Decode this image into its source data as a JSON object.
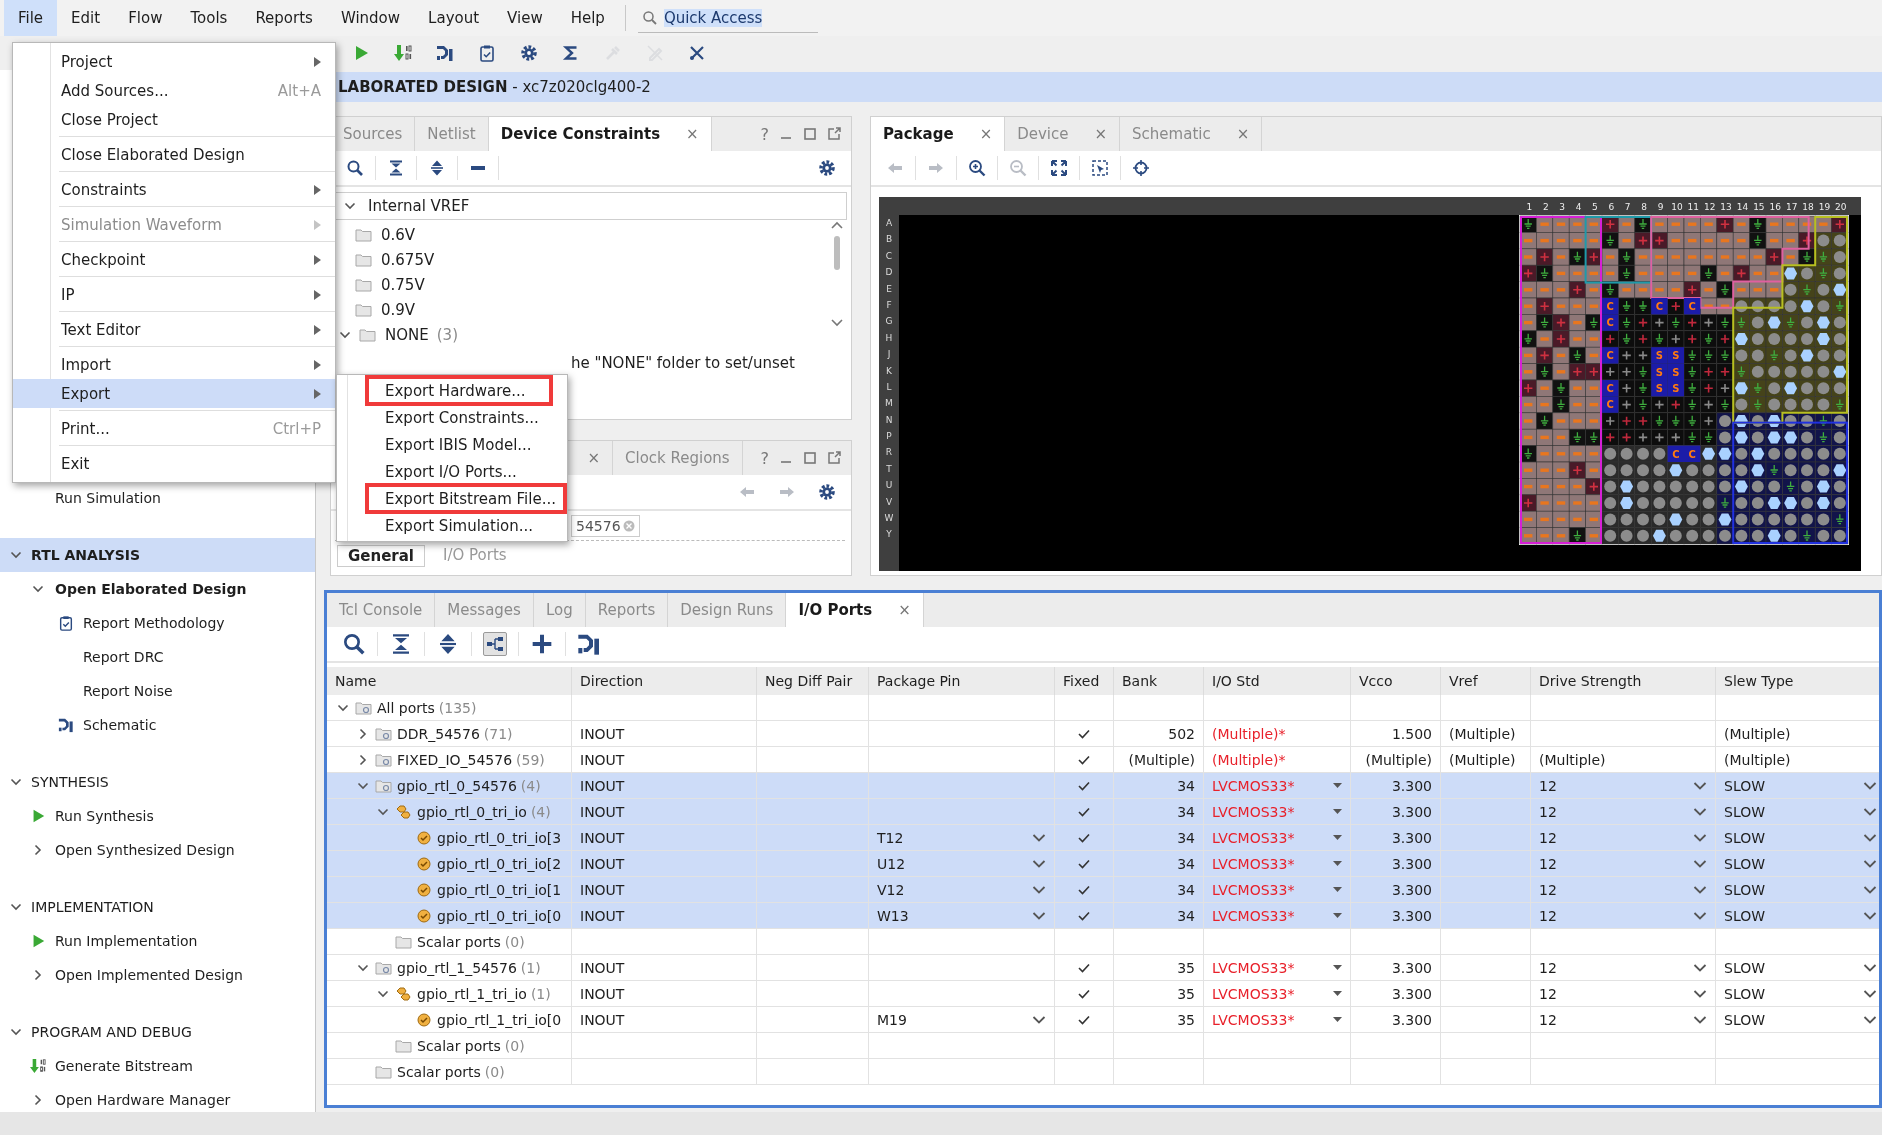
{
  "menu_bar": {
    "items": [
      {
        "label": "File",
        "selected": true
      },
      {
        "label": "Edit",
        "selected": false
      },
      {
        "label": "Flow",
        "selected": false
      },
      {
        "label": "Tools",
        "selected": false
      },
      {
        "label": "Reports",
        "selected": false
      },
      {
        "label": "Window",
        "selected": false
      },
      {
        "label": "Layout",
        "selected": false
      },
      {
        "label": "View",
        "selected": false
      },
      {
        "label": "Help",
        "selected": false
      }
    ]
  },
  "quick_access": {
    "value": "Quick Access"
  },
  "toolbar": [
    {
      "kind": "run",
      "disabled": false
    },
    {
      "kind": "bitstream",
      "disabled": false
    },
    {
      "kind": "schematic",
      "disabled": false
    },
    {
      "kind": "report",
      "disabled": false
    },
    {
      "kind": "settings",
      "disabled": false
    },
    {
      "kind": "sum",
      "disabled": false
    },
    {
      "kind": "probe",
      "disabled": true
    },
    {
      "kind": "pen",
      "disabled": true
    },
    {
      "kind": "tools",
      "disabled": false
    }
  ],
  "design_header": "**LABORATED DESIGN** - xc7z020clg400-2",
  "flow_navigator": {
    "sections": [
      {
        "items": [
          {
            "label": "Run Simulation"
          }
        ]
      },
      {
        "title": "RTL ANALYSIS",
        "expanded": true,
        "selected": true,
        "items": [
          {
            "label": "Open Elaborated Design",
            "expanded": true,
            "active": true,
            "children": [
              {
                "label": "Report Methodology",
                "kind": "report"
              },
              {
                "label": "Report DRC"
              },
              {
                "label": "Report Noise"
              },
              {
                "label": "Schematic",
                "kind": "schematic"
              }
            ]
          }
        ]
      },
      {
        "title": "SYNTHESIS",
        "expanded": true,
        "selected": false,
        "items": [
          {
            "label": "Run Synthesis",
            "kind": "run"
          },
          {
            "label": "Open Synthesized Design",
            "expanded": false,
            "active": false
          }
        ]
      },
      {
        "title": "IMPLEMENTATION",
        "expanded": true,
        "selected": false,
        "items": [
          {
            "label": "Run Implementation",
            "kind": "run"
          },
          {
            "label": "Open Implemented Design",
            "expanded": false,
            "active": false
          }
        ]
      },
      {
        "title": "PROGRAM AND DEBUG",
        "expanded": true,
        "selected": false,
        "items": [
          {
            "label": "Generate Bitstream",
            "kind": "bitstream"
          },
          {
            "label": "Open Hardware Manager",
            "expanded": false,
            "active": false
          }
        ]
      }
    ]
  },
  "device_constraints_panel": {
    "tabs": [
      {
        "label": "Sources",
        "selected": false
      },
      {
        "label": "Netlist",
        "selected": false
      },
      {
        "label": "Device Constraints",
        "selected": true,
        "close": "×"
      }
    ],
    "help": "?",
    "toolbar": [
      {
        "kind": "search",
        "disabled": false
      },
      {
        "kind": "collapse",
        "disabled": false
      },
      {
        "kind": "expand",
        "disabled": false
      },
      {
        "kind": "minus",
        "disabled": false
      },
      {
        "kind": "settings",
        "disabled": false
      }
    ],
    "tree_header": {
      "label": "Internal VREF",
      "expanded": true
    },
    "tree": [
      {
        "label": "0.6V"
      },
      {
        "label": "0.675V"
      },
      {
        "label": "0.75V"
      },
      {
        "label": "0.9V"
      },
      {
        "label": "NONE",
        "count": "(3)",
        "expanded": true
      }
    ],
    "hint": "he \"NONE\" folder to set/unset"
  },
  "properties_panel": {
    "tabs": [
      {
        "close": "×",
        "selected": false
      },
      {
        "label": "Clock Regions",
        "selected": false
      }
    ],
    "help": "?",
    "toolbar": [
      {
        "kind": "back",
        "disabled": true
      },
      {
        "kind": "forward",
        "disabled": true
      },
      {
        "kind": "settings",
        "disabled": false
      }
    ],
    "filter_value": "54576",
    "bottom_tabs": [
      {
        "label": "General",
        "selected": true
      },
      {
        "label": "I/O Ports",
        "selected": false
      }
    ]
  },
  "package_panel": {
    "tabs": [
      {
        "label": "Package",
        "selected": true,
        "close": "×"
      },
      {
        "label": "Device",
        "selected": false,
        "close": "×"
      },
      {
        "label": "Schematic",
        "selected": false,
        "close": "×"
      }
    ],
    "toolbar": [
      {
        "kind": "back",
        "disabled": true
      },
      {
        "kind": "forward",
        "disabled": true
      },
      {
        "kind": "zoom_in",
        "disabled": false
      },
      {
        "kind": "zoom_out",
        "disabled": true
      },
      {
        "kind": "fit",
        "disabled": false
      },
      {
        "kind": "zoom_area",
        "disabled": false
      },
      {
        "kind": "locate",
        "disabled": false
      }
    ],
    "column_labels": [
      "1",
      "2",
      "3",
      "4",
      "5",
      "6",
      "7",
      "8",
      "9",
      "10",
      "11",
      "12",
      "13",
      "14",
      "15",
      "16",
      "17",
      "18",
      "19",
      "20"
    ],
    "row_labels": [
      "A",
      "B",
      "C",
      "D",
      "E",
      "F",
      "G",
      "H",
      "J",
      "K",
      "L",
      "M",
      "N",
      "P",
      "R",
      "T",
      "U",
      "V",
      "W",
      "Y"
    ],
    "pin_labels": [
      {
        "text": "C"
      },
      {
        "text": "C"
      },
      {
        "text": "C"
      },
      {
        "text": "C"
      },
      {
        "text": "C"
      },
      {
        "text": "C"
      },
      {
        "text": "C"
      },
      {
        "text": "S"
      },
      {
        "text": "S"
      },
      {
        "text": "S"
      },
      {
        "text": "S"
      },
      {
        "text": "S"
      },
      {
        "text": "S"
      },
      {
        "text": "C"
      },
      {
        "text": "C"
      }
    ]
  },
  "bottom_panel": {
    "tabs": [
      {
        "label": "Tcl Console",
        "selected": false
      },
      {
        "label": "Messages",
        "selected": false
      },
      {
        "label": "Log",
        "selected": false
      },
      {
        "label": "Reports",
        "selected": false
      },
      {
        "label": "Design Runs",
        "selected": false
      },
      {
        "label": "I/O Ports",
        "selected": true,
        "close": "×"
      }
    ],
    "toolbar": [
      {
        "kind": "search",
        "pressed": false
      },
      {
        "kind": "collapse",
        "pressed": false
      },
      {
        "kind": "expand",
        "pressed": false
      },
      {
        "kind": "group",
        "pressed": true
      },
      {
        "kind": "plus",
        "pressed": false
      },
      {
        "kind": "schematic",
        "pressed": false
      }
    ],
    "columns": [
      "Name",
      "Direction",
      "Neg Diff Pair",
      "Package Pin",
      "Fixed",
      "Bank",
      "I/O Std",
      "Vcco",
      "Vref",
      "Drive Strength",
      "Slew Type"
    ],
    "rows": [
      {
        "name": "All ports",
        "count": "(135)",
        "kind": "group",
        "expanded": true,
        "selected": false,
        "children": [
          {
            "name": "DDR_54576",
            "count": "(71)",
            "kind": "group",
            "expanded": false,
            "selected": false,
            "direction": "INOUT",
            "fixed": true,
            "bank": "502",
            "io_std": "(Multiple)*",
            "vcco": "1.500",
            "vref": "(Multiple)",
            "slew_type": "(Multiple)",
            "editable": false
          },
          {
            "name": "FIXED_IO_54576",
            "count": "(59)",
            "kind": "group",
            "expanded": false,
            "selected": false,
            "direction": "INOUT",
            "fixed": true,
            "bank": "(Multiple)",
            "io_std": "(Multiple)*",
            "vcco": "(Multiple)",
            "vref": "(Multiple)",
            "drive_strength": "(Multiple)",
            "slew_type": "(Multiple)",
            "editable": false
          },
          {
            "name": "gpio_rtl_0_54576",
            "count": "(4)",
            "kind": "group",
            "expanded": true,
            "selected": true,
            "direction": "INOUT",
            "fixed": true,
            "bank": "34",
            "io_std": "LVCMOS33*",
            "vcco": "3.300",
            "drive_strength": "12",
            "slew_type": "SLOW",
            "editable": true,
            "children": [
              {
                "name": "gpio_rtl_0_tri_io",
                "count": "(4)",
                "kind": "bus",
                "expanded": true,
                "selected": true,
                "direction": "INOUT",
                "fixed": true,
                "bank": "34",
                "io_std": "LVCMOS33*",
                "vcco": "3.300",
                "drive_strength": "12",
                "slew_type": "SLOW",
                "editable": true,
                "children": [
                  {
                    "name": "gpio_rtl_0_tri_io[3",
                    "kind": "port",
                    "selected": true,
                    "direction": "INOUT",
                    "package_pin": "T12",
                    "fixed": true,
                    "bank": "34",
                    "io_std": "LVCMOS33*",
                    "vcco": "3.300",
                    "drive_strength": "12",
                    "slew_type": "SLOW",
                    "editable": true
                  },
                  {
                    "name": "gpio_rtl_0_tri_io[2",
                    "kind": "port",
                    "selected": true,
                    "direction": "INOUT",
                    "package_pin": "U12",
                    "fixed": true,
                    "bank": "34",
                    "io_std": "LVCMOS33*",
                    "vcco": "3.300",
                    "drive_strength": "12",
                    "slew_type": "SLOW",
                    "editable": true
                  },
                  {
                    "name": "gpio_rtl_0_tri_io[1",
                    "kind": "port",
                    "selected": true,
                    "direction": "INOUT",
                    "package_pin": "V12",
                    "fixed": true,
                    "bank": "34",
                    "io_std": "LVCMOS33*",
                    "vcco": "3.300",
                    "drive_strength": "12",
                    "slew_type": "SLOW",
                    "editable": true
                  },
                  {
                    "name": "gpio_rtl_0_tri_io[0",
                    "kind": "port",
                    "selected": true,
                    "direction": "INOUT",
                    "package_pin": "W13",
                    "fixed": true,
                    "bank": "34",
                    "io_std": "LVCMOS33*",
                    "vcco": "3.300",
                    "drive_strength": "12",
                    "slew_type": "SLOW",
                    "editable": true
                  }
                ]
              },
              {
                "name": "Scalar ports",
                "count": "(0)",
                "kind": "folder",
                "selected": false
              }
            ]
          },
          {
            "name": "gpio_rtl_1_54576",
            "count": "(1)",
            "kind": "group",
            "expanded": true,
            "selected": false,
            "direction": "INOUT",
            "fixed": true,
            "bank": "35",
            "io_std": "LVCMOS33*",
            "vcco": "3.300",
            "drive_strength": "12",
            "slew_type": "SLOW",
            "editable": true,
            "children": [
              {
                "name": "gpio_rtl_1_tri_io",
                "count": "(1)",
                "kind": "bus",
                "expanded": true,
                "selected": false,
                "direction": "INOUT",
                "fixed": true,
                "bank": "35",
                "io_std": "LVCMOS33*",
                "vcco": "3.300",
                "drive_strength": "12",
                "slew_type": "SLOW",
                "editable": true,
                "children": [
                  {
                    "name": "gpio_rtl_1_tri_io[0",
                    "kind": "port",
                    "selected": false,
                    "direction": "INOUT",
                    "package_pin": "M19",
                    "fixed": true,
                    "bank": "35",
                    "io_std": "LVCMOS33*",
                    "vcco": "3.300",
                    "drive_strength": "12",
                    "slew_type": "SLOW",
                    "editable": true
                  }
                ]
              },
              {
                "name": "Scalar ports",
                "count": "(0)",
                "kind": "folder",
                "selected": false
              }
            ]
          },
          {
            "name": "Scalar ports",
            "count": "(0)",
            "kind": "folder",
            "selected": false
          }
        ]
      }
    ]
  },
  "file_menu": {
    "groups": [
      [
        {
          "label": "Project",
          "submenu": true,
          "disabled": false,
          "selected": false
        },
        {
          "label": "Add Sources...",
          "shortcut": "Alt+A",
          "disabled": false,
          "selected": false
        },
        {
          "label": "Close Project",
          "disabled": false,
          "selected": false
        }
      ],
      [
        {
          "label": "Close Elaborated Design",
          "disabled": false,
          "selected": false
        }
      ],
      [
        {
          "label": "Constraints",
          "submenu": true,
          "disabled": false,
          "selected": false
        }
      ],
      [
        {
          "label": "Simulation Waveform",
          "submenu": true,
          "disabled": true,
          "selected": false
        }
      ],
      [
        {
          "label": "Checkpoint",
          "submenu": true,
          "disabled": false,
          "selected": false
        }
      ],
      [
        {
          "label": "IP",
          "submenu": true,
          "disabled": false,
          "selected": false
        }
      ],
      [
        {
          "label": "Text Editor",
          "submenu": true,
          "disabled": false,
          "selected": false
        }
      ],
      [
        {
          "label": "Import",
          "submenu": true,
          "disabled": false,
          "selected": false
        },
        {
          "label": "Export",
          "submenu": true,
          "disabled": false,
          "selected": true
        }
      ],
      [
        {
          "label": "Print...",
          "shortcut": "Ctrl+P",
          "disabled": false,
          "selected": false
        }
      ],
      [
        {
          "label": "Exit",
          "disabled": false,
          "selected": false
        }
      ]
    ]
  },
  "export_submenu": {
    "items": [
      {
        "label": "Export Hardware...",
        "highlighted": true
      },
      {
        "label": "Export Constraints...",
        "highlighted": false
      },
      {
        "label": "Export IBIS Model...",
        "highlighted": false
      },
      {
        "label": "Export I/O Ports...",
        "highlighted": false
      },
      {
        "label": "Export Bitstream File...",
        "highlighted": true
      },
      {
        "label": "Export Simulation...",
        "highlighted": false
      }
    ]
  }
}
